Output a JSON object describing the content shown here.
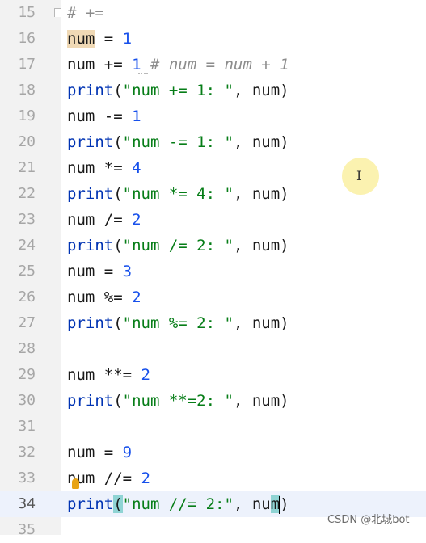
{
  "editor": {
    "lines": [
      {
        "number": "15",
        "code": "# +="
      },
      {
        "number": "16",
        "code": "num = 1"
      },
      {
        "number": "17",
        "code": "num += 1 # num = num + 1"
      },
      {
        "number": "18",
        "code": "print(\"num += 1: \", num)"
      },
      {
        "number": "19",
        "code": "num -= 1"
      },
      {
        "number": "20",
        "code": "print(\"num -= 1: \", num)"
      },
      {
        "number": "21",
        "code": "num *= 4"
      },
      {
        "number": "22",
        "code": "print(\"num *= 4: \", num)"
      },
      {
        "number": "23",
        "code": "num /= 2"
      },
      {
        "number": "24",
        "code": "print(\"num /= 2: \", num)"
      },
      {
        "number": "25",
        "code": "num = 3"
      },
      {
        "number": "26",
        "code": "num %= 2"
      },
      {
        "number": "27",
        "code": "print(\"num %= 2: \", num)"
      },
      {
        "number": "28",
        "code": ""
      },
      {
        "number": "29",
        "code": "num **= 2"
      },
      {
        "number": "30",
        "code": "print(\"num **=2: \", num)"
      },
      {
        "number": "31",
        "code": ""
      },
      {
        "number": "32",
        "code": "num = 9"
      },
      {
        "number": "33",
        "code": "num //= 2"
      },
      {
        "number": "34",
        "code": "print(\"num //= 2:\", num)"
      },
      {
        "number": "35",
        "code": ""
      }
    ],
    "current_line": "34",
    "cursor_glyph": "I",
    "icons": [
      "fold-icon",
      "bulb-icon"
    ]
  },
  "watermark": "CSDN @北城bot",
  "colors": {
    "keyword": "#0033b3",
    "string": "#067d17",
    "number": "#1750eb",
    "comment": "#8c8c8c",
    "current_line_bg": "#edf2fc",
    "brace_match": "#8fd4d4"
  }
}
